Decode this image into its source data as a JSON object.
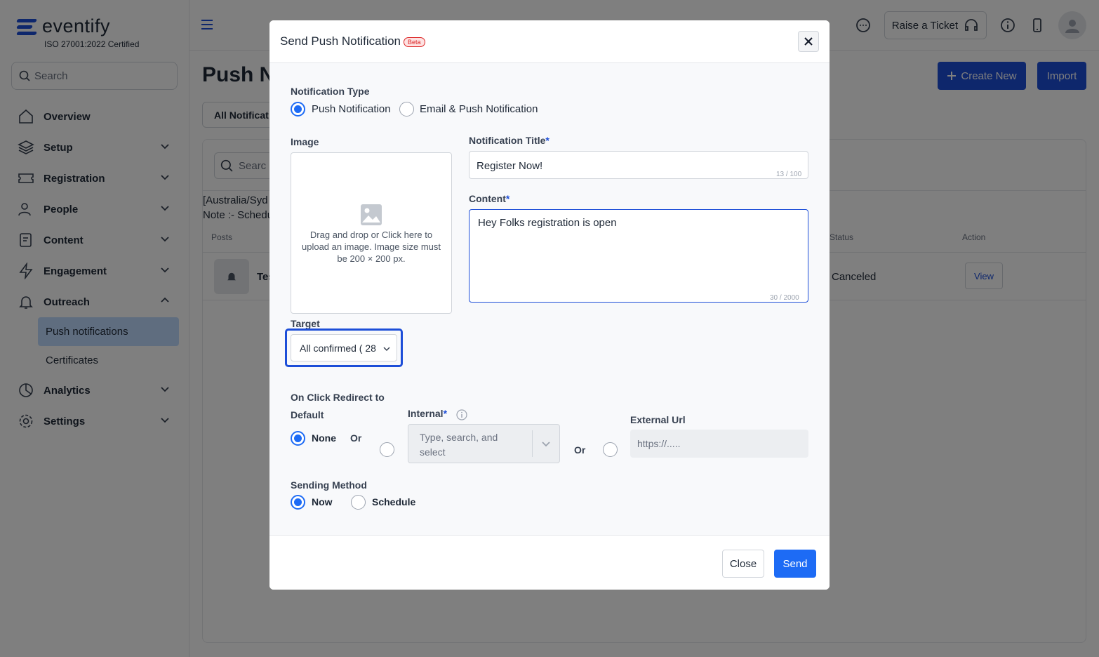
{
  "app": {
    "brand": "eventify",
    "certification": "ISO 27001:2022 Certified",
    "search_placeholder": "Search",
    "accent_color": "#1d4ed8"
  },
  "sidebar": {
    "items": [
      {
        "label": "Overview",
        "icon": "home-icon"
      },
      {
        "label": "Setup",
        "icon": "layers-icon"
      },
      {
        "label": "Registration",
        "icon": "ticket-icon"
      },
      {
        "label": "People",
        "icon": "people-icon"
      },
      {
        "label": "Content",
        "icon": "document-icon"
      },
      {
        "label": "Engagement",
        "icon": "lightning-icon"
      },
      {
        "label": "Outreach",
        "icon": "bell-icon"
      },
      {
        "label": "Analytics",
        "icon": "pie-chart-icon"
      },
      {
        "label": "Settings",
        "icon": "gear-icon"
      }
    ],
    "outreach_sub": [
      "Push notifications",
      "Certificates"
    ]
  },
  "header": {
    "raise_ticket": "Raise a Ticket"
  },
  "page": {
    "title": "Push N",
    "create_new": "Create New",
    "import": "Import",
    "filter_tab": "All Notificat",
    "search_placeholder": "Searc",
    "timezone_line": "[Australia/Syd",
    "note_line": "Note :- Schedu",
    "columns": {
      "posts": "Posts",
      "status": "Status",
      "action": "Action"
    },
    "row": {
      "name": "Tes",
      "status": "Canceled",
      "action": "View"
    }
  },
  "modal": {
    "title": "Send Push Notification",
    "badge": "Beta",
    "notification_type": {
      "label": "Notification Type",
      "options": [
        "Push Notification",
        "Email & Push Notification"
      ],
      "selected": "Push Notification"
    },
    "image": {
      "label": "Image",
      "dropzone_text": "Drag and drop or Click here to upload an image. Image size must be 200 × 200 px."
    },
    "title_field": {
      "label": "Notification Title",
      "value": "Register Now!",
      "counter": "13 / 100"
    },
    "content_field": {
      "label": "Content",
      "value": "Hey Folks registration is open",
      "counter": "30 / 2000"
    },
    "target": {
      "label": "Target",
      "value": "All confirmed ( 28"
    },
    "redirect": {
      "label": "On Click Redirect to",
      "default_label": "Default",
      "none_label": "None",
      "or": "Or",
      "internal_label": "Internal",
      "internal_placeholder": "Type, search, and select",
      "external_label": "External Url",
      "external_placeholder": "https://....."
    },
    "sending": {
      "label": "Sending Method",
      "options": [
        "Now",
        "Schedule"
      ],
      "selected": "Now"
    },
    "footer": {
      "close": "Close",
      "send": "Send"
    }
  }
}
